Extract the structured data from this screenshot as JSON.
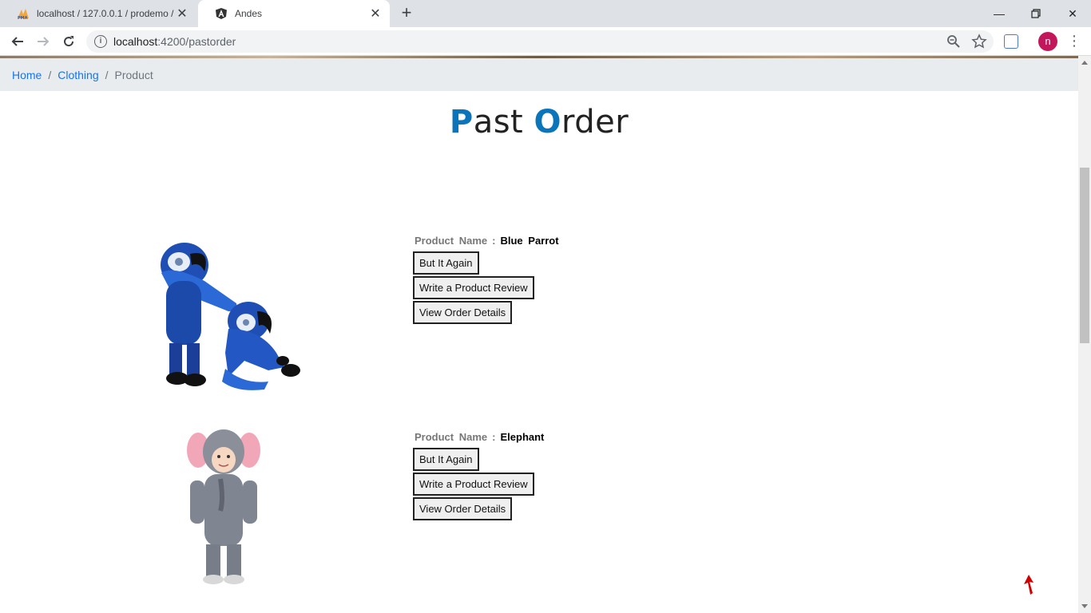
{
  "browser": {
    "tabs": [
      {
        "title": "localhost / 127.0.0.1 / prodemo / ",
        "icon": "phpmyadmin-icon",
        "active": false
      },
      {
        "title": "Andes",
        "icon": "angular-icon",
        "active": true
      }
    ],
    "url": {
      "host": "localhost",
      "path": ":4200/pastorder"
    },
    "profile_initial": "n"
  },
  "breadcrumb": {
    "items": [
      {
        "label": "Home",
        "link": true
      },
      {
        "label": "Clothing",
        "link": true
      },
      {
        "label": "Product",
        "link": false
      }
    ],
    "separator": "/"
  },
  "page": {
    "title_cap_1": "P",
    "title_rest_1": "ast ",
    "title_cap_2": "O",
    "title_rest_2": "rder"
  },
  "orders": [
    {
      "name_label": "Product Name",
      "colon": ":",
      "product_name": "Blue Parrot",
      "buttons": [
        "But It Again",
        "Write a Product Review",
        "View Order Details"
      ]
    },
    {
      "name_label": "Product Name",
      "colon": ":",
      "product_name": "Elephant",
      "buttons": [
        "But It Again",
        "Write a Product Review",
        "View Order Details"
      ]
    }
  ],
  "colors": {
    "accent": "#0a75bb",
    "link": "#1a73e8",
    "breadcrumb_bg": "#e9ecef",
    "scroll_top_arrow": "#d40000"
  }
}
